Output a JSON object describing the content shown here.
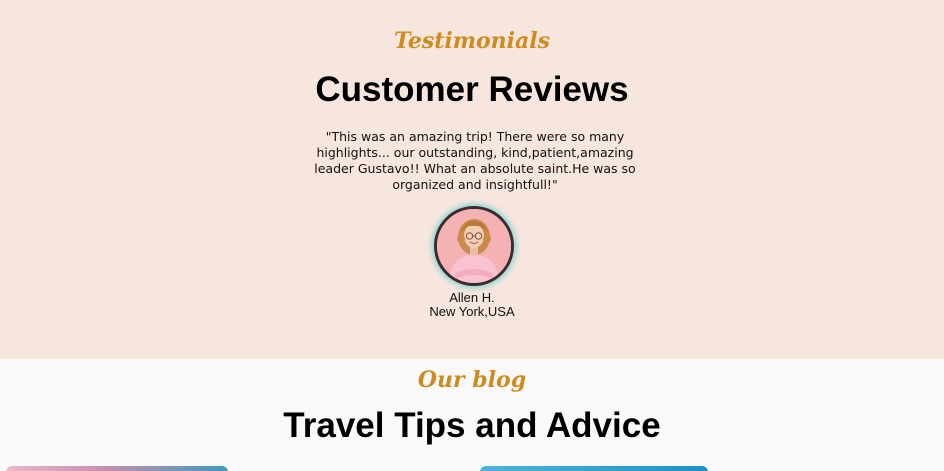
{
  "testimonials": {
    "eyebrow": "Testimonials",
    "title": "Customer Reviews",
    "quote": "\"This was an amazing trip! There were so many highlights... our outstanding, kind,patient,amazing leader Gustavo!! What an absolute saint.He was so organized and insightfull!\"",
    "reviewer": {
      "name": "Allen H.",
      "location": "New York,USA"
    }
  },
  "blog": {
    "eyebrow": "Our blog",
    "title": "Travel Tips and Advice"
  },
  "colors": {
    "accent": "#cf8b1e",
    "testimonials_bg": "#f7e6de",
    "blog_bg": "#f9f9f9"
  }
}
